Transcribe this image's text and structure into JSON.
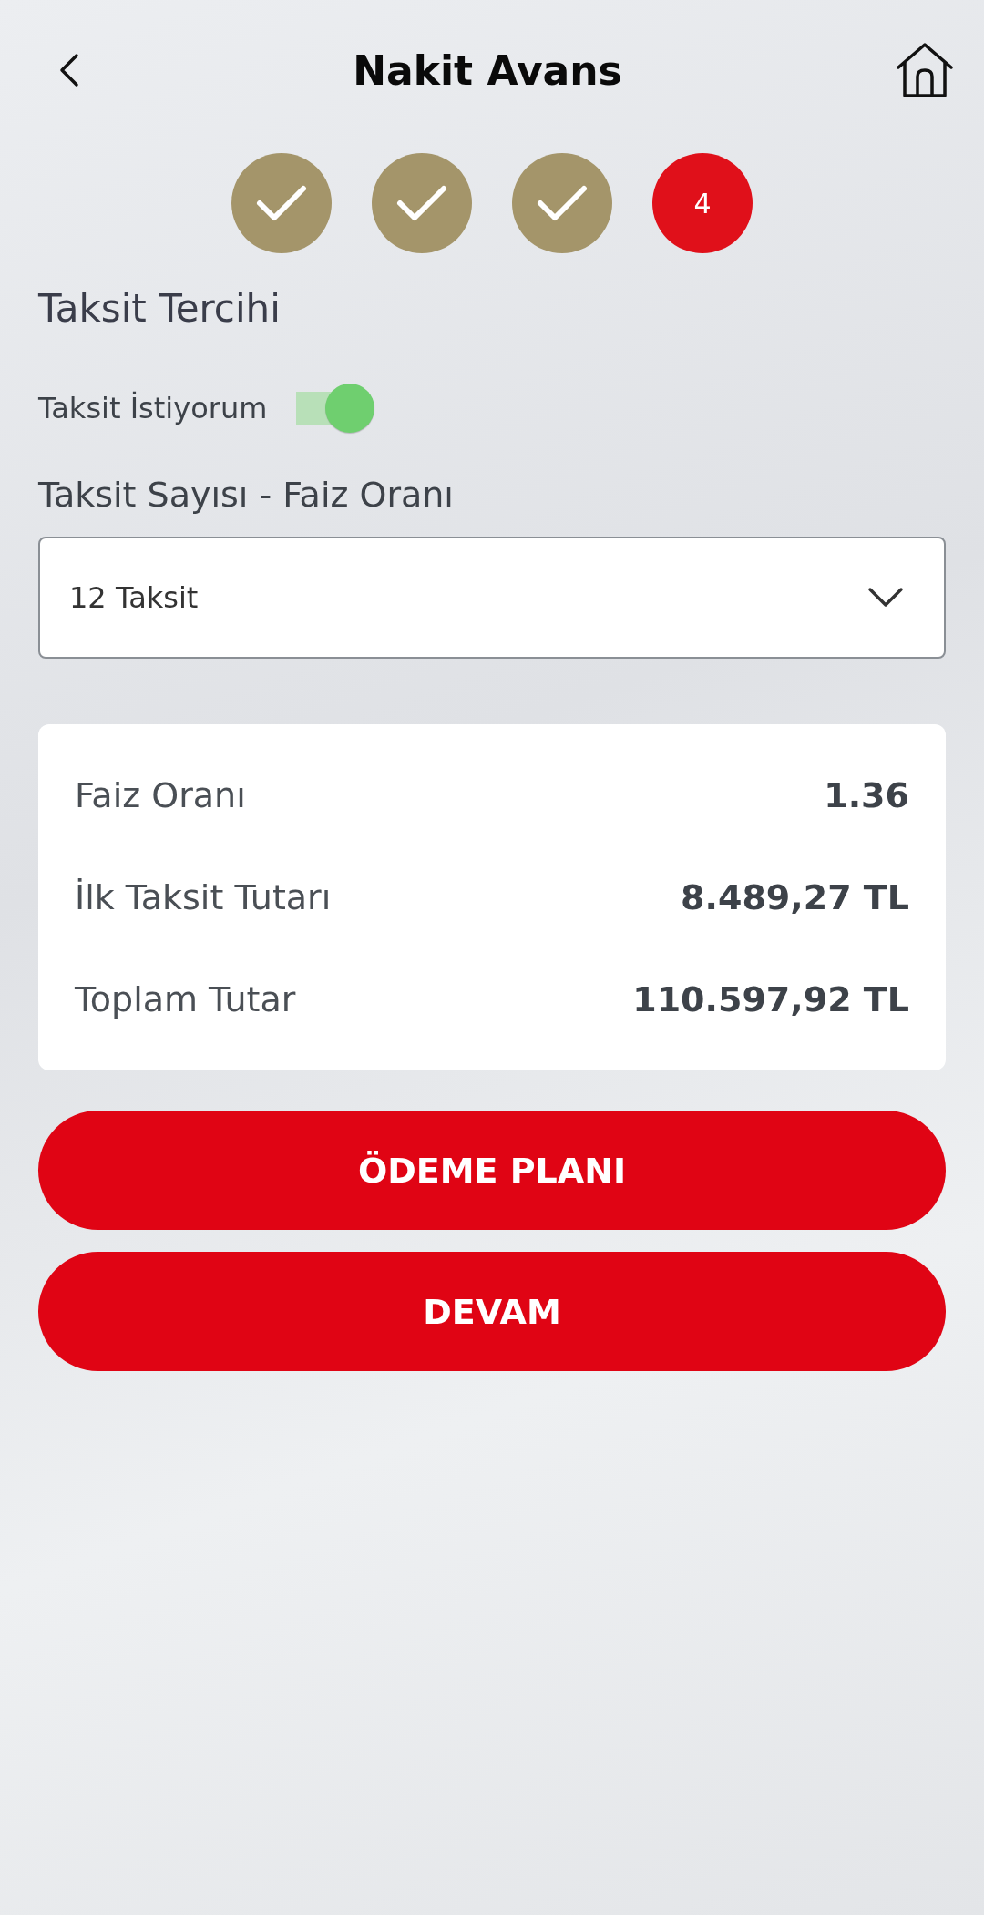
{
  "header": {
    "title": "Nakit Avans"
  },
  "steps": [
    {
      "completed": true
    },
    {
      "completed": true
    },
    {
      "completed": true
    },
    {
      "completed": false,
      "label": "4"
    }
  ],
  "section_title": "Taksit Tercihi",
  "installment_toggle": {
    "label": "Taksit İstiyorum",
    "on": true
  },
  "select_label": "Taksit Sayısı - Faiz Oranı",
  "select": {
    "value": "12 Taksit"
  },
  "summary": [
    {
      "label": "Faiz Oranı",
      "value": "1.36"
    },
    {
      "label": "İlk Taksit Tutarı",
      "value": "8.489,27 TL"
    },
    {
      "label": "Toplam Tutar",
      "value": "110.597,92 TL"
    }
  ],
  "buttons": [
    "ÖDEME PLANI",
    "DEVAM"
  ]
}
